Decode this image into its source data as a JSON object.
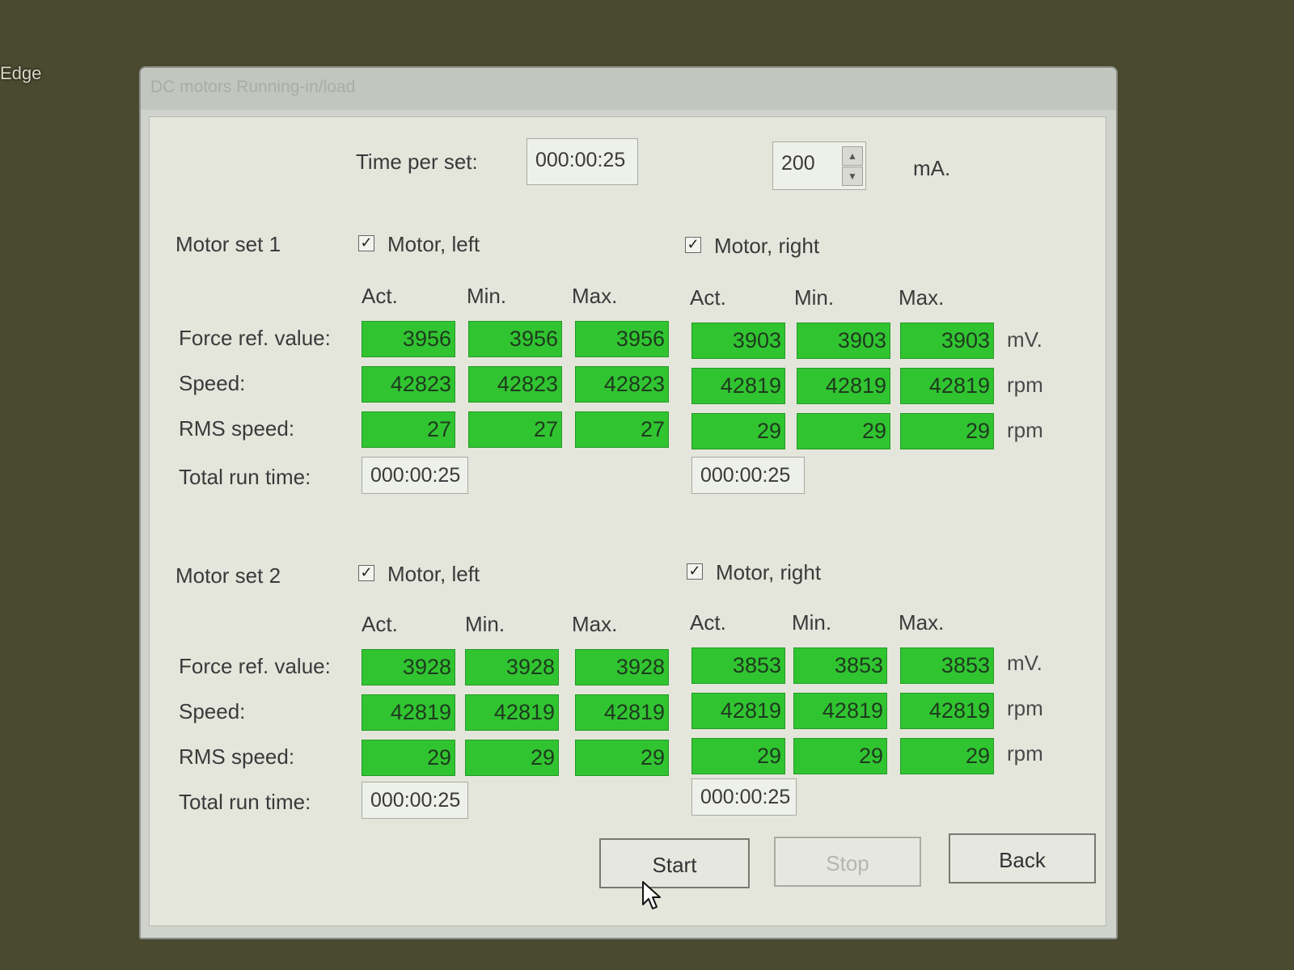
{
  "desktop": {
    "icon_label": "Edge"
  },
  "window": {
    "title": "DC motors Running-in/load"
  },
  "top": {
    "time_per_set_label": "Time per set:",
    "time_per_set_value": "000:00:25",
    "current_value": "200",
    "current_unit": "mA."
  },
  "columns": {
    "act": "Act.",
    "min": "Min.",
    "max": "Max."
  },
  "row_labels": {
    "force": "Force ref. value:",
    "speed": "Speed:",
    "rms": "RMS speed:",
    "total": "Total run time:"
  },
  "units": {
    "force": "mV.",
    "speed": "rpm",
    "rms": "rpm"
  },
  "sets": [
    {
      "label": "Motor set 1",
      "left": {
        "name": "Motor, left",
        "checked": true,
        "force": [
          "3956",
          "3956",
          "3956"
        ],
        "speed": [
          "42823",
          "42823",
          "42823"
        ],
        "rms": [
          "27",
          "27",
          "27"
        ],
        "total": "000:00:25"
      },
      "right": {
        "name": "Motor, right",
        "checked": true,
        "force": [
          "3903",
          "3903",
          "3903"
        ],
        "speed": [
          "42819",
          "42819",
          "42819"
        ],
        "rms": [
          "29",
          "29",
          "29"
        ],
        "total": "000:00:25"
      }
    },
    {
      "label": "Motor set 2",
      "left": {
        "name": "Motor, left",
        "checked": true,
        "force": [
          "3928",
          "3928",
          "3928"
        ],
        "speed": [
          "42819",
          "42819",
          "42819"
        ],
        "rms": [
          "29",
          "29",
          "29"
        ],
        "total": "000:00:25"
      },
      "right": {
        "name": "Motor, right",
        "checked": true,
        "force": [
          "3853",
          "3853",
          "3853"
        ],
        "speed": [
          "42819",
          "42819",
          "42819"
        ],
        "rms": [
          "29",
          "29",
          "29"
        ],
        "total": "000:00:25"
      }
    }
  ],
  "buttons": {
    "start": "Start",
    "stop": "Stop",
    "back": "Back"
  },
  "colors": {
    "value_cell": "#31c431",
    "window_bg": "#e4e6dc"
  }
}
